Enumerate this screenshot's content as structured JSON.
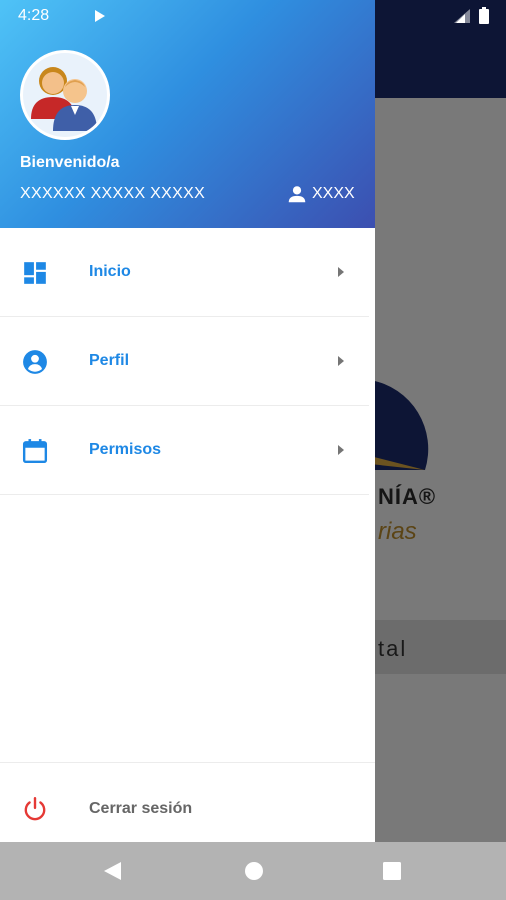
{
  "status_bar": {
    "time": "4:28"
  },
  "background": {
    "logo_text": "NÍA®",
    "logo_sub": "rias",
    "band_text": "tal"
  },
  "drawer": {
    "header": {
      "welcome": "Bienvenido/a",
      "user_name": "XXXXXX XXXXX XXXXX",
      "user_code": "XXXX"
    },
    "menu": [
      {
        "label": "Inicio",
        "icon": "dashboard-icon"
      },
      {
        "label": "Perfil",
        "icon": "account-circle-icon"
      },
      {
        "label": "Permisos",
        "icon": "calendar-icon"
      }
    ],
    "logout_label": "Cerrar sesión"
  },
  "colors": {
    "accent": "#1e88e5",
    "logout_icon": "#e53935",
    "header_gradient": [
      "#4fc3f7",
      "#2f8fe0",
      "#3c4fb0"
    ]
  }
}
